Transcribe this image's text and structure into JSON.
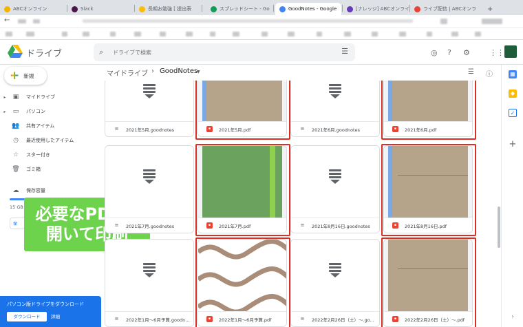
{
  "browser": {
    "tabs": [
      {
        "label": "ABCオンライン",
        "color": "#f4b400"
      },
      {
        "label": "Slack",
        "color": "#4a154b"
      },
      {
        "label": "長期お勉強 [ 提出表",
        "color": "#fbbc04"
      },
      {
        "label": "スプレッドシート - Go",
        "color": "#0f9d58"
      },
      {
        "label": "GoodNotes - Google",
        "color": "#4285f4"
      },
      {
        "label": "[ナレッジ] ABCオンライン",
        "color": "#673ab7"
      },
      {
        "label": "ライブ配信 | ABCオンライン",
        "color": "#ea4335"
      }
    ],
    "active_tab_index": 4
  },
  "drive": {
    "brand": "ドライブ",
    "search_placeholder": "ドライブで検索",
    "new_button": "新規",
    "nav": [
      {
        "label": "マイドライブ",
        "icon": "my-drive-icon",
        "glyph": "▣",
        "expandable": true
      },
      {
        "label": "パソコン",
        "icon": "computer-icon",
        "glyph": "▭",
        "expandable": true
      },
      {
        "label": "共有アイテム",
        "icon": "shared-icon",
        "glyph": "👥",
        "expandable": false
      },
      {
        "label": "最近使用したアイテム",
        "icon": "recent-icon",
        "glyph": "◷",
        "expandable": false
      },
      {
        "label": "スター付き",
        "icon": "star-icon",
        "glyph": "☆",
        "expandable": false
      },
      {
        "label": "ゴミ箱",
        "icon": "trash-icon",
        "glyph": "🗑",
        "expandable": false
      }
    ],
    "storage_label": "保存容量",
    "storage_text": "15 GB",
    "storage_button": "保",
    "overlay_text": "必要なPDFを\n開いて印刷",
    "download_panel": {
      "title": "パソコン版ドライブをダウンロード",
      "download_button": "ダウンロード",
      "details_link": "詳細"
    },
    "breadcrumb": {
      "root": "マイドライブ",
      "current": "GoodNotes"
    },
    "files": [
      {
        "name": "2021年5月.goodnotes",
        "type": "goodnotes",
        "thumb": "glyph",
        "highlighted": false
      },
      {
        "name": "2021年5月.pdf",
        "type": "pdf",
        "thumb": "tan-blue",
        "highlighted": true
      },
      {
        "name": "2021年6月.goodnotes",
        "type": "goodnotes",
        "thumb": "glyph",
        "highlighted": false
      },
      {
        "name": "2021年6月.pdf",
        "type": "pdf",
        "thumb": "tan-blue",
        "highlighted": true
      },
      {
        "name": "2021年7月.goodnotes",
        "type": "goodnotes",
        "thumb": "glyph",
        "highlighted": false
      },
      {
        "name": "2021年7月.pdf",
        "type": "pdf",
        "thumb": "green",
        "highlighted": true
      },
      {
        "name": "2021年8月16日.goodnotes",
        "type": "goodnotes",
        "thumb": "glyph",
        "highlighted": false
      },
      {
        "name": "2021年8月16日.pdf",
        "type": "pdf",
        "thumb": "tan-blue",
        "highlighted": true
      },
      {
        "name": "2022年1月〜6月予算.goodn...",
        "type": "goodnotes",
        "thumb": "glyph",
        "highlighted": false
      },
      {
        "name": "2022年1月〜6月予算.pdf",
        "type": "pdf",
        "thumb": "waves",
        "highlighted": true
      },
      {
        "name": "2022年2月26日（土）〜.go...",
        "type": "goodnotes",
        "thumb": "glyph",
        "highlighted": false
      },
      {
        "name": "2022年2月26日（土）〜.pdf",
        "type": "pdf",
        "thumb": "tan-lines",
        "highlighted": true
      }
    ],
    "colors": {
      "accent": "#1a73e8",
      "highlight": "#d93025",
      "overlay": "#6dd34c",
      "tan": "#b5a48a",
      "green": "#6ba35e"
    }
  }
}
